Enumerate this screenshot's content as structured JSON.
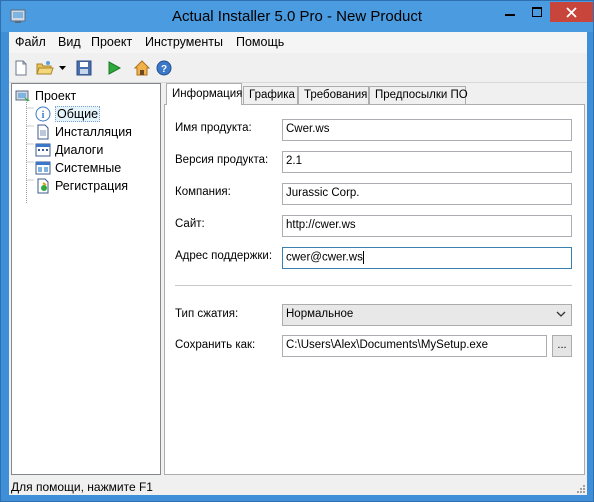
{
  "window": {
    "title": "Actual Installer 5.0 Pro - New Product"
  },
  "menu": {
    "items": [
      "Файл",
      "Вид",
      "Проект",
      "Инструменты",
      "Помощь"
    ]
  },
  "toolbar": {
    "icons": [
      "new-document-icon",
      "open-folder-icon",
      "dropdown-arrow-icon",
      "save-icon",
      "build-run-icon",
      "home-icon",
      "help-icon"
    ]
  },
  "tree": {
    "root": "Проект",
    "items": [
      {
        "label": "Общие",
        "icon": "info-icon",
        "selected": true
      },
      {
        "label": "Инсталляция",
        "icon": "document-icon",
        "selected": false
      },
      {
        "label": "Диалоги",
        "icon": "dialogs-icon",
        "selected": false
      },
      {
        "label": "Системные",
        "icon": "system-icon",
        "selected": false
      },
      {
        "label": "Регистрация",
        "icon": "registration-icon",
        "selected": false
      }
    ]
  },
  "tabs": [
    "Информация",
    "Графика",
    "Требования",
    "Предпосылки ПО"
  ],
  "form": {
    "product_name_label": "Имя продукта:",
    "product_name_value": "Cwer.ws",
    "product_version_label": "Версия продукта:",
    "product_version_value": "2.1",
    "company_label": "Компания:",
    "company_value": "Jurassic Corp.",
    "site_label": "Сайт:",
    "site_value": "http://cwer.ws",
    "support_label": "Адрес поддержки:",
    "support_value": "cwer@cwer.ws",
    "compression_label": "Тип сжатия:",
    "compression_value": "Нормальное",
    "save_as_label": "Сохранить как:",
    "save_as_value": "C:\\Users\\Alex\\Documents\\MySetup.exe",
    "browse_label": "..."
  },
  "status": {
    "text": "Для помощи, нажмите F1"
  },
  "colors": {
    "titlebar": "#4a9be0",
    "close_button": "#c7453a",
    "selection": "#e5f3fb"
  }
}
